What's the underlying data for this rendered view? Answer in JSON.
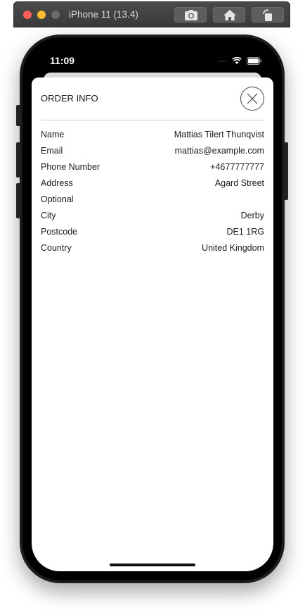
{
  "simulator": {
    "device_label": "iPhone 11 (13.4)"
  },
  "status_bar": {
    "time": "11:09"
  },
  "sheet": {
    "title": "ORDER INFO",
    "rows": [
      {
        "label": "Name",
        "value": "Mattias Tilert Thunqvist"
      },
      {
        "label": "Email",
        "value": "mattias@example.com"
      },
      {
        "label": "Phone Number",
        "value": "+4677777777"
      },
      {
        "label": "Address",
        "value": "Agard Street"
      },
      {
        "label": "Optional",
        "value": ""
      },
      {
        "label": "City",
        "value": "Derby"
      },
      {
        "label": "Postcode",
        "value": "DE1 1RG"
      },
      {
        "label": "Country",
        "value": "United Kingdom"
      }
    ]
  },
  "colors": {
    "sheet_background": "#ffffff",
    "text": "#1a1a1a",
    "divider": "#cfcfcf",
    "phone_frame": "#1c1c1c"
  },
  "icons": {
    "close": "close-icon",
    "screenshot": "camera-icon",
    "home": "home-icon",
    "rotate": "rotate-icon",
    "wifi": "wifi-icon",
    "battery": "battery-icon"
  }
}
